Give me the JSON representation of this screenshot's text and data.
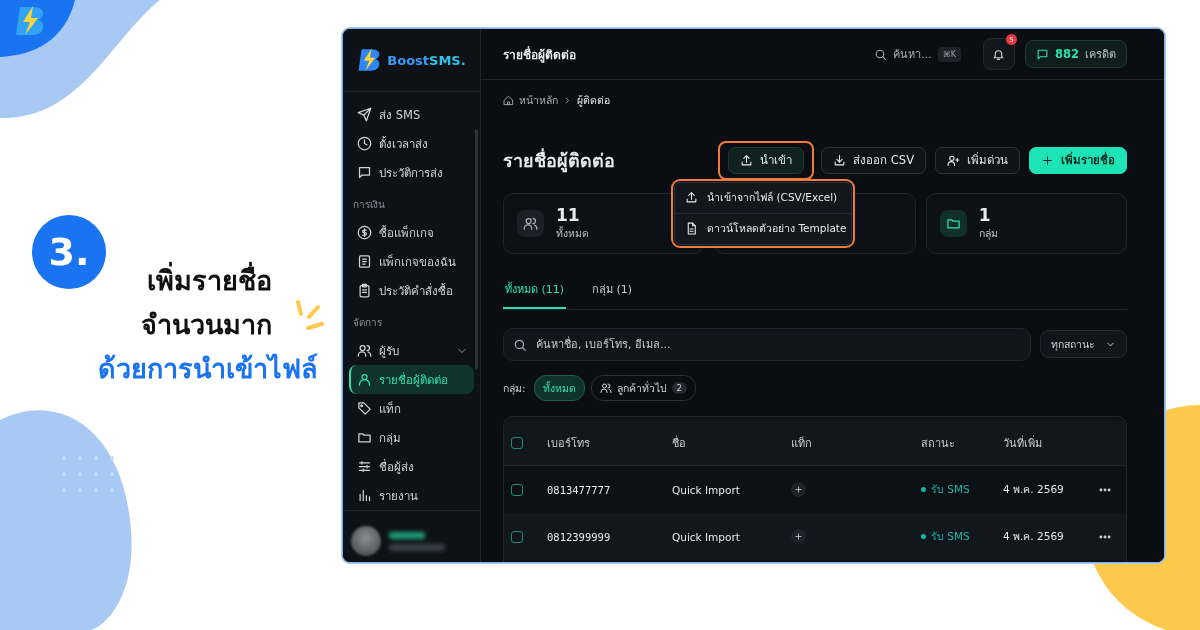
{
  "promo": {
    "step": "3.",
    "heading_lines": [
      "เพิ่มรายชื่อ",
      "จำนวนมาก"
    ],
    "highlight": "ด้วยการนำเข้าไฟล์"
  },
  "sidebar": {
    "brand": "Boost",
    "brand_accent": "SMS.",
    "sections": [
      {
        "items": [
          {
            "label": "ส่ง SMS",
            "kind": "link",
            "selected": false
          },
          {
            "label": "ตั้งเวลาส่ง",
            "kind": "link",
            "selected": false
          },
          {
            "label": "ประวัติการส่ง",
            "kind": "link",
            "selected": false
          }
        ]
      },
      {
        "title": "การเงิน",
        "items": [
          {
            "label": "ซื้อแพ็กเกจ",
            "kind": "link",
            "selected": false
          },
          {
            "label": "แพ็กเกจของฉัน",
            "kind": "link",
            "selected": false
          },
          {
            "label": "ประวัติคำสั่งซื้อ",
            "kind": "link",
            "selected": false
          }
        ]
      },
      {
        "title": "จัดการ",
        "items": [
          {
            "label": "ผู้รับ",
            "kind": "group",
            "expanded": true,
            "selected": false
          },
          {
            "label": "รายชื่อผู้ติดต่อ",
            "kind": "link",
            "selected": true
          },
          {
            "label": "แท็ก",
            "kind": "link",
            "selected": false
          },
          {
            "label": "กลุ่ม",
            "kind": "link",
            "selected": false
          },
          {
            "label": "ชื่อผู้ส่ง",
            "kind": "link",
            "selected": false
          },
          {
            "label": "รายงาน",
            "kind": "link",
            "selected": false
          }
        ]
      }
    ]
  },
  "topbar": {
    "title": "รายชื่อผู้ติดต่อ",
    "search": {
      "placeholder": "ค้นหา...",
      "shortcut": "⌘K"
    },
    "notifications": "5",
    "credits": {
      "value": "882",
      "label": "เครดิต"
    }
  },
  "breadcrumb": [
    "หน้าหลัก",
    "ผู้ติดต่อ"
  ],
  "page_title": "รายชื่อผู้ติดต่อ",
  "actions": [
    {
      "label": "นำเข้า",
      "kind": "import",
      "highlighted": true
    },
    {
      "label": "ส่งออก CSV",
      "kind": "export",
      "highlighted": false
    },
    {
      "label": "เพิ่มด่วน",
      "kind": "quick",
      "highlighted": false
    },
    {
      "label": "เพิ่มรายชื่อ",
      "kind": "primary",
      "highlighted": false
    }
  ],
  "import_menu": {
    "highlighted": true,
    "items": [
      {
        "label": "นำเข้าจากไฟล์ (CSV/Excel)",
        "kind": "upload"
      },
      {
        "label": "ดาวน์โหลดตัวอย่าง Template",
        "kind": "file"
      }
    ]
  },
  "stats": [
    {
      "kind": "people",
      "value": "11",
      "label": "ทั้งหมด"
    },
    {
      "kind": "covered"
    },
    {
      "kind": "folder",
      "value": "1",
      "label": "กลุ่ม"
    }
  ],
  "tabs": [
    {
      "label": "ทั้งหมด (11)",
      "selected": true
    },
    {
      "label": "กลุ่ม (1)",
      "selected": false
    }
  ],
  "search": {
    "placeholder": "ค้นหาชื่อ, เบอร์โทร, อีเมล..."
  },
  "status_filter": "ทุกสถานะ",
  "group_filter": {
    "label": "กลุ่ม:",
    "chips": [
      {
        "label": "ทั้งหมด",
        "selected": true
      },
      {
        "label": "ลูกค้าทั่วไป",
        "count": "2",
        "selected": false
      }
    ]
  },
  "table": {
    "select_all": {
      "checked": false
    },
    "columns": [
      "เบอร์โทร",
      "ชื่อ",
      "แท็ก",
      "สถานะ",
      "วันที่เพิ่ม"
    ],
    "rows": [
      {
        "checked": false,
        "phone": "0813477777",
        "name": "Quick Import",
        "status": "รับ SMS",
        "color": "#14b8a6",
        "date": "4 พ.ค. 2569"
      },
      {
        "checked": false,
        "phone": "0812399999",
        "name": "Quick Import",
        "status": "รับ SMS",
        "color": "#14b8a6",
        "date": "4 พ.ค. 2569"
      }
    ]
  }
}
